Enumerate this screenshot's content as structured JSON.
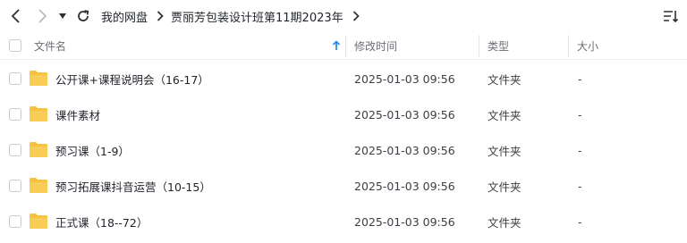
{
  "toolbar": {
    "back_icon": "chevron-left-icon",
    "forward_icon": "chevron-right-icon",
    "history_icon": "caret-down-icon",
    "refresh_icon": "refresh-icon",
    "view_icon": "sort-list-icon"
  },
  "breadcrumb": {
    "items": [
      "我的网盘",
      "贾丽芳包装设计班第11期2023年"
    ]
  },
  "header": {
    "name": "文件名",
    "modified": "修改时间",
    "type": "类型",
    "size": "大小",
    "sort_icon": "arrow-up-icon"
  },
  "files": [
    {
      "name": "公开课+课程说明会（16-17）",
      "modified": "2025-01-03 09:56",
      "type": "文件夹",
      "size": "-"
    },
    {
      "name": "课件素材",
      "modified": "2025-01-03 09:56",
      "type": "文件夹",
      "size": "-"
    },
    {
      "name": "预习课（1-9）",
      "modified": "2025-01-03 09:56",
      "type": "文件夹",
      "size": "-"
    },
    {
      "name": "预习拓展课抖音运营（10-15）",
      "modified": "2025-01-03 09:56",
      "type": "文件夹",
      "size": "-"
    },
    {
      "name": "正式课（18--72）",
      "modified": "2025-01-03 09:56",
      "type": "文件夹",
      "size": "-"
    }
  ],
  "colors": {
    "folder": "#f5c242",
    "accent": "#2b8cf0"
  }
}
